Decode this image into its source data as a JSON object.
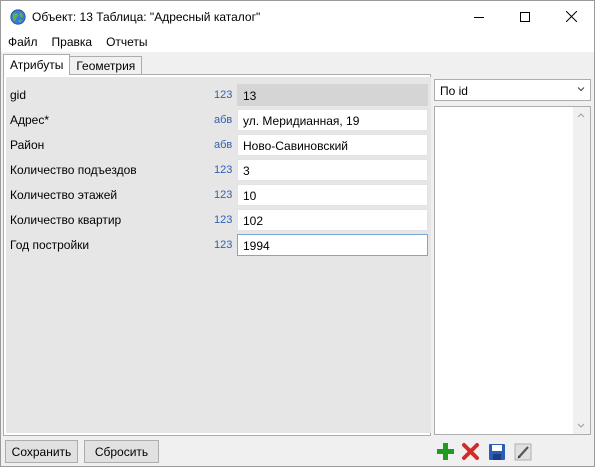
{
  "window": {
    "title": "Объект: 13 Таблица: \"Адресный каталог\"",
    "icon": "globe-icon"
  },
  "menu": [
    "Файл",
    "Правка",
    "Отчеты"
  ],
  "tabs": [
    "Атрибуты",
    "Геометрия"
  ],
  "attributes": [
    {
      "label": "gid",
      "type": "123",
      "value": "13"
    },
    {
      "label": "Адрес*",
      "type": "абв",
      "value": "ул. Меридианная, 19"
    },
    {
      "label": "Район",
      "type": "абв",
      "value": "Ново-Савиновский"
    },
    {
      "label": "Количество подъездов",
      "type": "123",
      "value": "3"
    },
    {
      "label": "Количество этажей",
      "type": "123",
      "value": "10"
    },
    {
      "label": "Количество квартир",
      "type": "123",
      "value": "102"
    },
    {
      "label": "Год постройки",
      "type": "123",
      "value": "1994"
    }
  ],
  "sort": {
    "selected": "По id"
  },
  "buttons": {
    "save": "Сохранить",
    "reset": "Сбросить"
  },
  "toolbar": [
    "add-icon",
    "delete-icon",
    "save-icon",
    "edit-icon"
  ],
  "colors": {
    "type_hint": "#2f5fb3",
    "add": "#1f9c1f",
    "delete": "#d42a2a",
    "save": "#2d5bb8"
  }
}
